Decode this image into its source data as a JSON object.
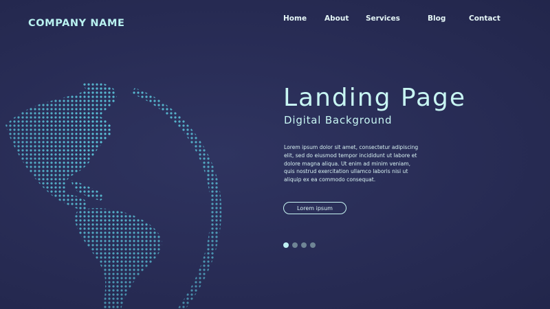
{
  "brand": {
    "name": "COMPANY NAME"
  },
  "nav": {
    "items": [
      "Home",
      "About",
      "Services",
      "Blog",
      "Contact"
    ]
  },
  "hero": {
    "title": "Landing Page",
    "subtitle": "Digital Background",
    "body": "Lorem ipsum dolor sit amet, consectetur adipiscing elit, sed do eiusmod tempor incididunt ut labore et dolore magna aliqua. Ut enim ad minim veniam, quis nostrud exercitation ullamco laboris nisi ut aliquip ex ea commodo consequat.",
    "cta_label": "Lorem ipsum"
  },
  "slider": {
    "count": 4,
    "active_index": 0
  },
  "colors": {
    "background": "#282c55",
    "accent": "#c8f6f3",
    "dots": "#5cc6dc"
  },
  "icons": [
    "world-globe-icon"
  ]
}
